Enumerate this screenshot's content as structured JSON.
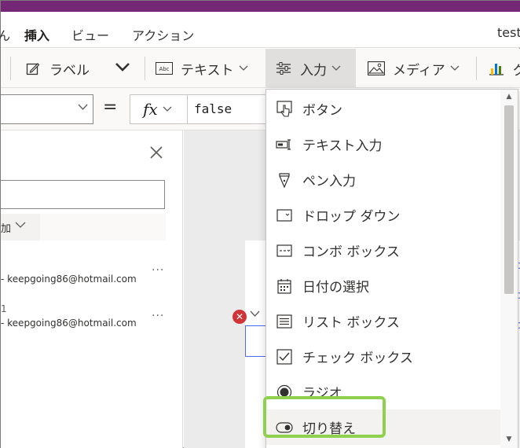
{
  "menubar": {
    "tabs": [
      {
        "label": "挿入",
        "active": true
      },
      {
        "label": "ビュー",
        "active": false
      },
      {
        "label": "アクション",
        "active": false
      }
    ],
    "app_name_partial": "test"
  },
  "ribbon": {
    "label_button": "ラベル",
    "text_button": "テキスト",
    "input_button": "入力",
    "media_button": "メディア",
    "text_icon_glyph": "Abc",
    "partial_right_label": "グ"
  },
  "formulabar": {
    "equals": "=",
    "fx_label": "fx",
    "formula_value": "false"
  },
  "leftpanel": {
    "add_strip_label": "加",
    "items": [
      {
        "prefix": "-",
        "email": "keepgoing86@hotmail.com"
      },
      {
        "prefix": "1",
        "email": "keepgoing86@hotmail.com"
      }
    ],
    "more": "···"
  },
  "dropdown": {
    "items": [
      {
        "label": "ボタン",
        "icon": "button-hand-icon"
      },
      {
        "label": "テキスト入力",
        "icon": "text-input-icon"
      },
      {
        "label": "ペン入力",
        "icon": "pen-input-icon"
      },
      {
        "label": "ドロップ ダウン",
        "icon": "dropdown-icon"
      },
      {
        "label": "コンボ ボックス",
        "icon": "combobox-icon"
      },
      {
        "label": "日付の選択",
        "icon": "calendar-icon"
      },
      {
        "label": "リスト ボックス",
        "icon": "listbox-icon"
      },
      {
        "label": "チェック ボックス",
        "icon": "checkbox-icon"
      },
      {
        "label": "ラジオ",
        "icon": "radio-icon"
      },
      {
        "label": "切り替え",
        "icon": "toggle-icon"
      }
    ]
  },
  "colors": {
    "titlebar": "#742774",
    "highlight": "#8fd14f",
    "error": "#d13438",
    "selection": "#4f6bed"
  }
}
